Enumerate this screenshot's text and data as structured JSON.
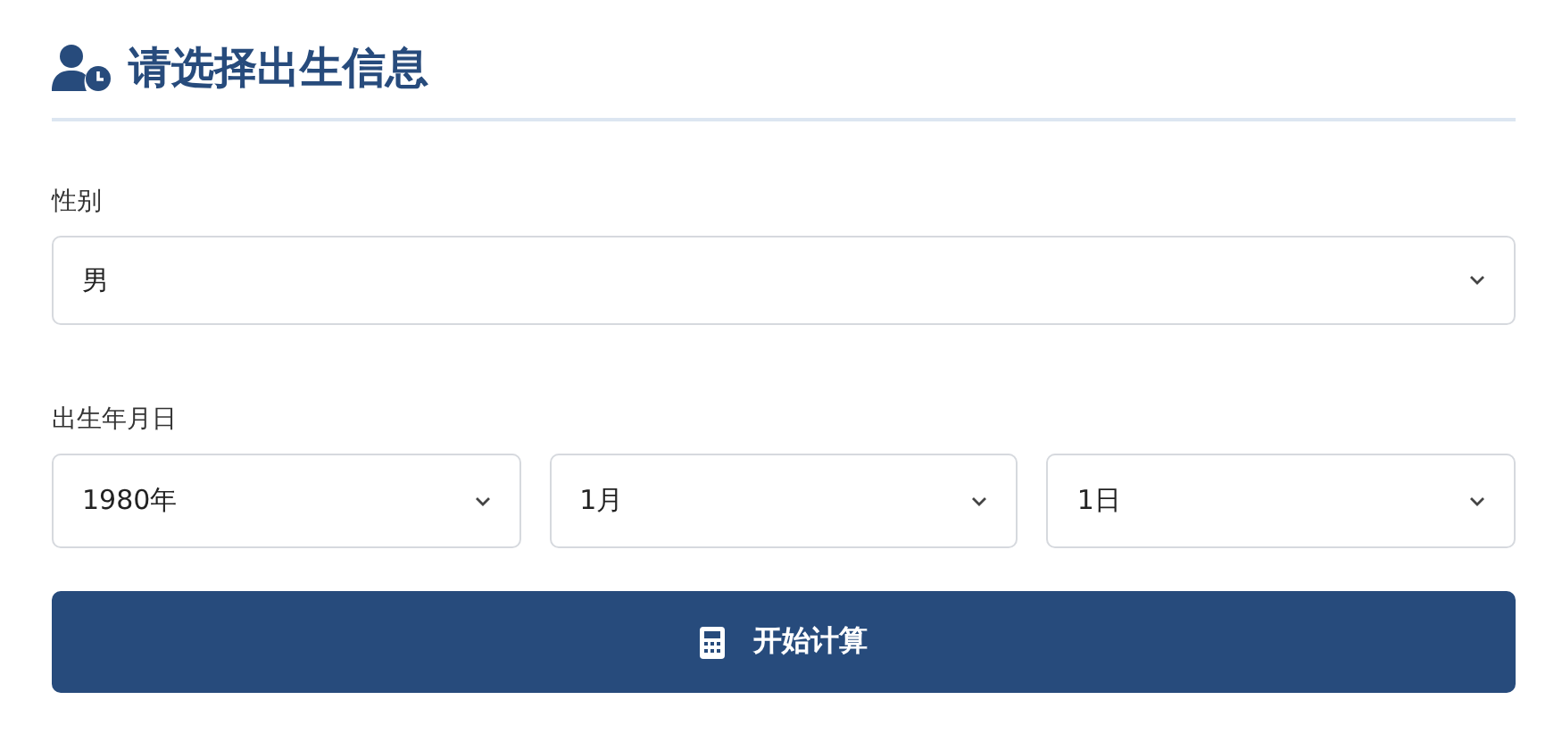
{
  "header": {
    "title": "请选择出生信息"
  },
  "gender": {
    "label": "性别",
    "value": "男"
  },
  "birth_date": {
    "label": "出生年月日",
    "selects": [
      {
        "value": "1980年"
      },
      {
        "value": "1月"
      },
      {
        "value": "1日"
      }
    ]
  },
  "submit_button": {
    "label": "开始计算"
  }
}
